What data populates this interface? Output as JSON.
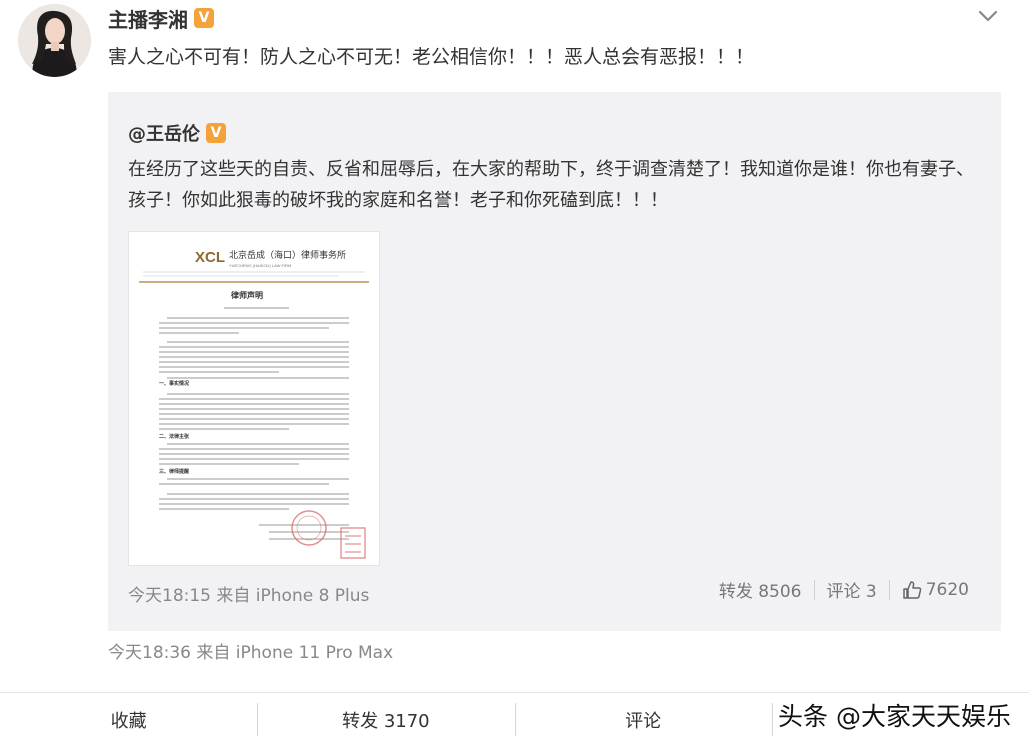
{
  "post": {
    "username": "主播李湘",
    "verified_badge": "V",
    "text": "害人之心不可有！防人之心不可无！老公相信你！！！恶人总会有恶报！！！",
    "source": "今天18:36 来自 iPhone 11 Pro Max"
  },
  "repost": {
    "username": "@王岳伦",
    "verified_badge": "V",
    "text": "在经历了这些天的自责、反省和屈辱后，在大家的帮助下，终于调查清楚了！我知道你是谁！你也有妻子、孩子！你如此狠毒的破坏我的家庭和名誉！老子和你死磕到底！！！",
    "source": "今天18:15 来自 iPhone 8 Plus",
    "repost_label": "转发 8506",
    "comment_label": "评论 3",
    "like_count": "7620",
    "doc": {
      "firm_name": "北京岳成（海口）律师事务所",
      "firm_name_en": "YUECHENG (HAIKOU) LAW FIRM",
      "title": "律师声明",
      "sections": [
        "一、事实情况",
        "二、法律主张",
        "三、律师提醒"
      ]
    }
  },
  "bottom_bar": {
    "favorite": "收藏",
    "repost": "转发 3170",
    "comment": "评论"
  },
  "watermark": "头条 @大家天天娱乐",
  "colors": {
    "badge": "#f3a33a",
    "repost_bg": "#f2f2f5",
    "muted_text": "#888888"
  }
}
